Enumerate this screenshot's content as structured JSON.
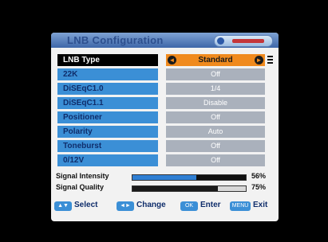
{
  "window": {
    "title": "LNB Configuration"
  },
  "settings": [
    {
      "label": "LNB Type",
      "value": "Standard"
    },
    {
      "label": "22K",
      "value": "Off"
    },
    {
      "label": "DiSEqC1.0",
      "value": "1/4"
    },
    {
      "label": "DiSEqC1.1",
      "value": "Disable"
    },
    {
      "label": "Positioner",
      "value": "Off"
    },
    {
      "label": "Polarity",
      "value": "Auto"
    },
    {
      "label": "Toneburst",
      "value": "Off"
    },
    {
      "label": "0/12V",
      "value": "Off"
    }
  ],
  "signal": {
    "intensity": {
      "label": "Signal Intensity",
      "value_text": "56%",
      "level": 0.56
    },
    "quality": {
      "label": "Signal Quality",
      "value_text": "75%",
      "level": 0.75
    }
  },
  "footer": [
    {
      "key": "▲▼",
      "label": "Select",
      "icon": "up-down-key-icon"
    },
    {
      "key": "◄►",
      "label": "Change",
      "icon": "left-right-key-icon"
    },
    {
      "key": "OK",
      "label": "Enter",
      "icon": "ok-key-icon"
    },
    {
      "key": "MENU",
      "label": "Exit",
      "icon": "menu-key-icon"
    }
  ],
  "colors": {
    "label_bg": "#3b8fd6",
    "value_bg": "#aab1bc",
    "selected_value_bg": "#f08a1e",
    "intensity_bar": "#2f7fd3"
  }
}
